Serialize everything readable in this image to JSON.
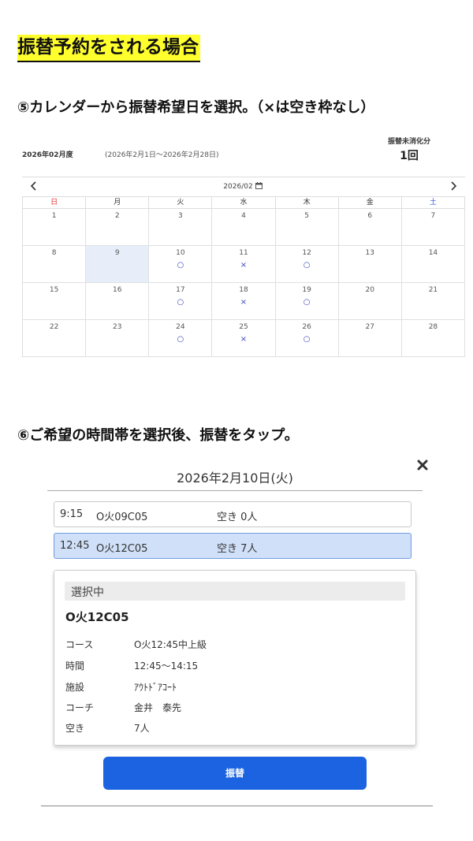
{
  "titles": {
    "main": "振替予約をされる場合",
    "step5": "⑤カレンダーから振替希望日を選択。（×は空き枠なし）",
    "step6": "⑥ご希望の時間帯を選択後、振替をタップ。"
  },
  "summary": {
    "fiscal_month": "2026年02月度",
    "range": "(2026年2月1日〜2026年2月28日)",
    "unused_label": "振替未消化分",
    "unused_count": "1回"
  },
  "calendar": {
    "month": "2026/02",
    "weekdays": [
      "日",
      "月",
      "火",
      "水",
      "木",
      "金",
      "土"
    ],
    "weeks": [
      [
        {
          "d": "1",
          "m": ""
        },
        {
          "d": "2",
          "m": ""
        },
        {
          "d": "3",
          "m": ""
        },
        {
          "d": "4",
          "m": ""
        },
        {
          "d": "5",
          "m": ""
        },
        {
          "d": "6",
          "m": ""
        },
        {
          "d": "7",
          "m": ""
        }
      ],
      [
        {
          "d": "8",
          "m": ""
        },
        {
          "d": "9",
          "m": "",
          "selected": true
        },
        {
          "d": "10",
          "m": "○"
        },
        {
          "d": "11",
          "m": "×"
        },
        {
          "d": "12",
          "m": "○"
        },
        {
          "d": "13",
          "m": ""
        },
        {
          "d": "14",
          "m": ""
        }
      ],
      [
        {
          "d": "15",
          "m": ""
        },
        {
          "d": "16",
          "m": ""
        },
        {
          "d": "17",
          "m": "○"
        },
        {
          "d": "18",
          "m": "×"
        },
        {
          "d": "19",
          "m": "○"
        },
        {
          "d": "20",
          "m": ""
        },
        {
          "d": "21",
          "m": ""
        }
      ],
      [
        {
          "d": "22",
          "m": ""
        },
        {
          "d": "23",
          "m": ""
        },
        {
          "d": "24",
          "m": "○"
        },
        {
          "d": "25",
          "m": "×"
        },
        {
          "d": "26",
          "m": "○"
        },
        {
          "d": "27",
          "m": ""
        },
        {
          "d": "28",
          "m": ""
        }
      ]
    ]
  },
  "modal": {
    "title": "2026年2月10日(火)",
    "slots": [
      {
        "time": "9:15",
        "code": "O火09C05",
        "vacancy": "空き 0人"
      },
      {
        "time": "12:45",
        "code": "O火12C05",
        "vacancy": "空き 7人"
      }
    ],
    "detail": {
      "header": "選択中",
      "code": "O火12C05",
      "rows": [
        {
          "label": "コース",
          "value": "O火12:45中上級"
        },
        {
          "label": "時間",
          "value": "12:45〜14:15"
        },
        {
          "label": "施設",
          "value": "ｱｳﾄﾄﾞｱｺｰﾄ"
        },
        {
          "label": "コーチ",
          "value": "金井　泰先"
        },
        {
          "label": "空き",
          "value": "7人"
        }
      ]
    },
    "button_label": "振替"
  },
  "colors": {
    "highlight": "#ffff2e",
    "primary": "#1b63e0",
    "selected_slot": "#cfe0f8",
    "sunday": "#e03030",
    "saturday": "#2a5bd7",
    "avail_mark": "#3a49c0"
  }
}
